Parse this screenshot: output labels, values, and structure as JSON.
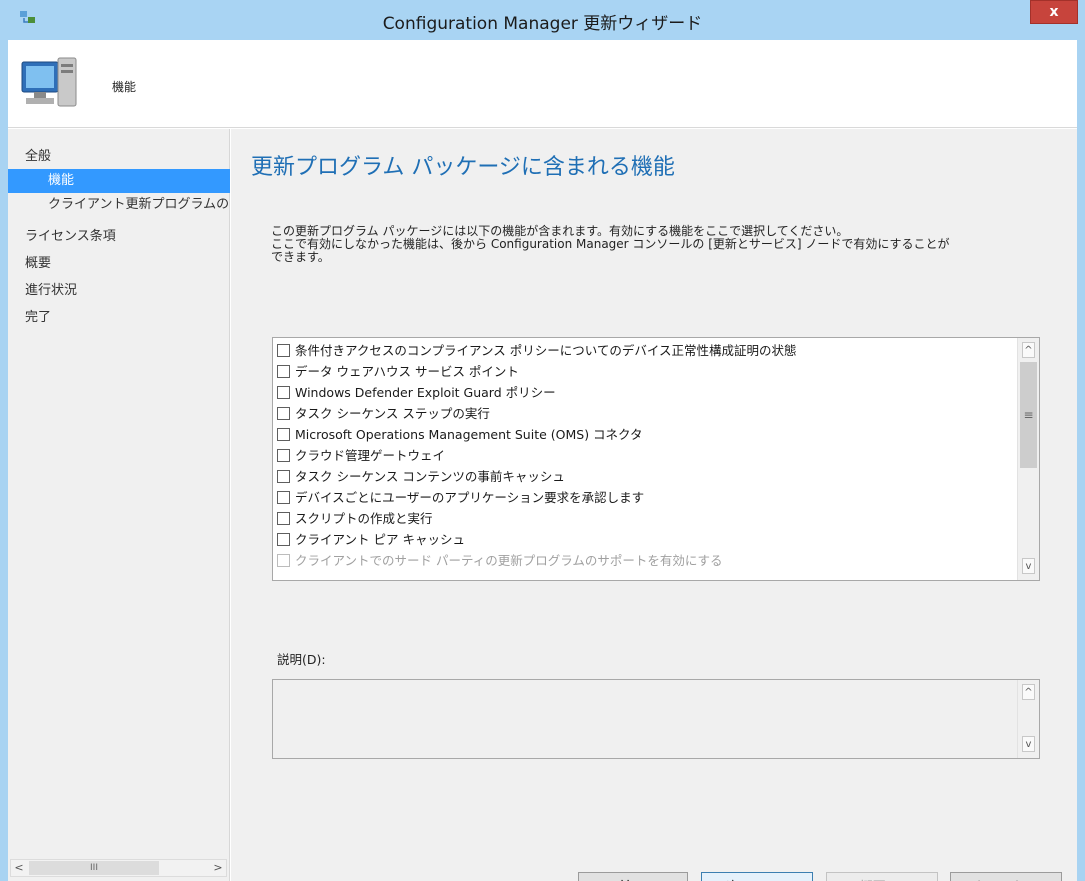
{
  "window": {
    "title": "Configuration Manager 更新ウィザード",
    "close_label": "x"
  },
  "header": {
    "title": "機能"
  },
  "sidebar": {
    "items": [
      {
        "label": "全般",
        "level": "top",
        "active": false
      },
      {
        "label": "機能",
        "level": "sub",
        "active": true
      },
      {
        "label": "クライアント更新プログラムの:",
        "level": "sub",
        "active": false
      },
      {
        "label": "ライセンス条項",
        "level": "top",
        "active": false
      },
      {
        "label": "概要",
        "level": "top",
        "active": false
      },
      {
        "label": "進行状況",
        "level": "top",
        "active": false
      },
      {
        "label": "完了",
        "level": "top",
        "active": false
      }
    ],
    "scroll_left": "<",
    "scroll_right": ">",
    "scroll_thumb": "III"
  },
  "main": {
    "page_title": "更新プログラム パッケージに含まれる機能",
    "description_lines": [
      "この更新プログラム パッケージには以下の機能が含まれます。有効にする機能をここで選択してください。",
      "ここで有効にしなかった機能は、後から Configuration Manager コンソールの [更新とサービス] ノードで有効にすることが",
      "できます。"
    ],
    "features": [
      {
        "label": "条件付きアクセスのコンプライアンス ポリシーについてのデバイス正常性構成証明の状態",
        "checked": false,
        "enabled": true
      },
      {
        "label": "データ ウェアハウス サービス ポイント",
        "checked": false,
        "enabled": true
      },
      {
        "label": "Windows Defender Exploit Guard ポリシー",
        "checked": false,
        "enabled": true
      },
      {
        "label": "タスク シーケンス ステップの実行",
        "checked": false,
        "enabled": true
      },
      {
        "label": "Microsoft Operations Management Suite (OMS) コネクタ",
        "checked": false,
        "enabled": true
      },
      {
        "label": "クラウド管理ゲートウェイ",
        "checked": false,
        "enabled": true
      },
      {
        "label": "タスク シーケンス コンテンツの事前キャッシュ",
        "checked": false,
        "enabled": true
      },
      {
        "label": "デバイスごとにユーザーのアプリケーション要求を承認します",
        "checked": false,
        "enabled": true
      },
      {
        "label": "スクリプトの作成と実行",
        "checked": false,
        "enabled": true
      },
      {
        "label": "クライアント ピア キャッシュ",
        "checked": false,
        "enabled": true
      },
      {
        "label": "クライアントでのサード パーティの更新プログラムのサポートを有効にする",
        "checked": false,
        "enabled": false
      }
    ],
    "scroll_up": "^",
    "scroll_down": "v",
    "scroll_thumb": "≡",
    "details_label": "説明(D):",
    "details_value": ""
  },
  "buttons": {
    "back": "< 前へ(P)",
    "next": "次へ(N) >",
    "summary": "概要(S)",
    "cancel": "キャンセル"
  },
  "colors": {
    "titlebar": "#a9d4f3",
    "accent": "#3399ff",
    "heading": "#1f6fb5",
    "close": "#c7443c"
  }
}
